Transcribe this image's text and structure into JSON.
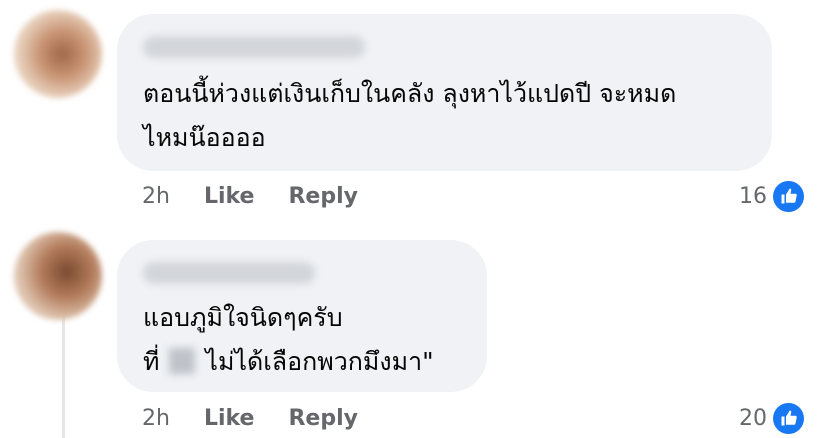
{
  "comments": [
    {
      "text_line1": "ตอนนี้ห่วงแต่เงินเก็บในคลัง ลุงหาไว้แปดปี จะหมด",
      "text_line2": "ไหมน๊ออออ",
      "time": "2h",
      "like_label": "Like",
      "reply_label": "Reply",
      "reaction_count": "16",
      "reaction_icon": "like-thumb-icon"
    },
    {
      "text_line1": "แอบภูมิใจนิดๆครับ",
      "text_line2_prefix": "ที่",
      "text_line2_suffix": "ไม่ได้เลือกพวกมึงมา\"",
      "time": "2h",
      "like_label": "Like",
      "reply_label": "Reply",
      "reaction_count": "20",
      "reaction_icon": "like-thumb-icon"
    }
  ],
  "colors": {
    "bubble_bg": "#f0f2f5",
    "meta_text": "#65676b",
    "like_blue": "#1877f2"
  }
}
